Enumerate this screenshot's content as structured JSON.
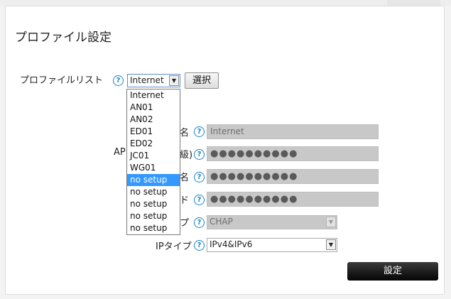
{
  "page": {
    "title": "プロファイル設定"
  },
  "profile_list": {
    "label": "プロファイルリスト",
    "help": "?",
    "selected": "Internet",
    "select_button": "選択",
    "options": [
      "Internet",
      "AN01",
      "AN02",
      "ED01",
      "ED02",
      "JC01",
      "WG01",
      "no setup",
      "no setup",
      "no setup",
      "no setup",
      "no setup"
    ],
    "highlighted_index": 7
  },
  "form": {
    "rows": [
      {
        "label": "名",
        "value": "Internet",
        "kind": "text"
      },
      {
        "label": "AP",
        "label_suffix": "級)",
        "value": "●●●●●●●●●●",
        "kind": "password"
      },
      {
        "label": "名",
        "value": "●●●●●●●●●●",
        "kind": "password"
      },
      {
        "label": "ド",
        "value": "●●●●●●●●●●",
        "kind": "password"
      }
    ],
    "auth_type": {
      "label": "プ",
      "value": "CHAP"
    },
    "ip_type": {
      "label": "IPタイプ",
      "value": "IPv4&IPv6"
    },
    "help": "?"
  },
  "submit": {
    "label": "設定"
  },
  "icons": {
    "select_arrow": "chevron-down-icon",
    "help": "help-circle-icon"
  },
  "colors": {
    "help_blue": "#1a84c7",
    "highlight": "#3399ff",
    "submit_bg": "#111111"
  }
}
